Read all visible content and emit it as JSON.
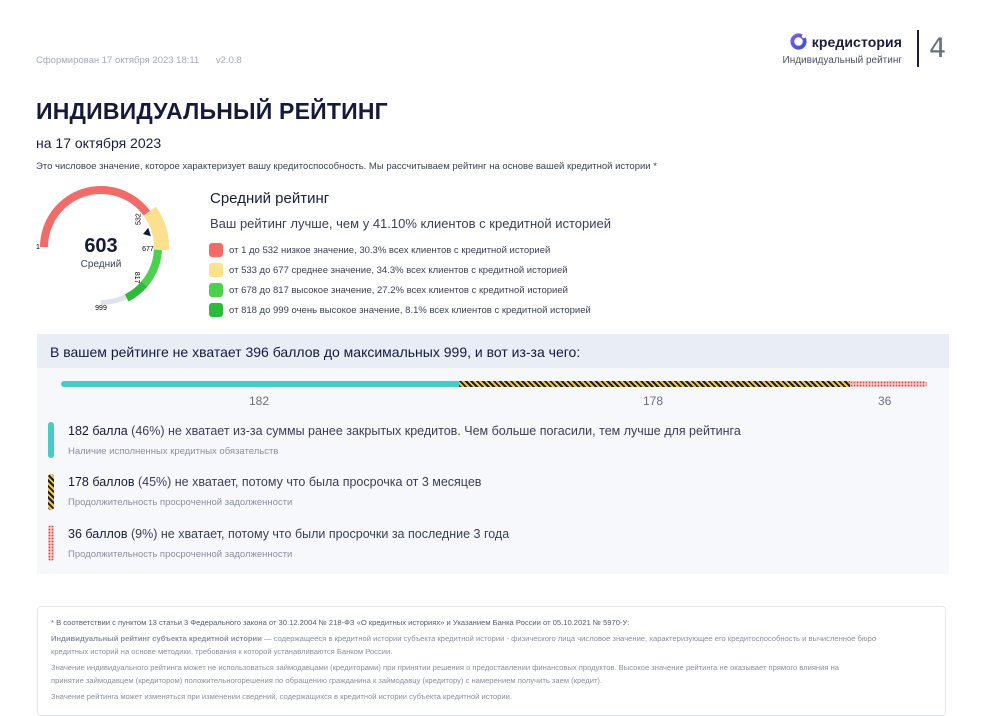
{
  "header": {
    "generated": "Сформирован 17 октября 2023 18:11",
    "version": "v2.0.8",
    "brand_name": "кредистория",
    "brand_sub": "Индивидуальный рейтинг",
    "page_number": "4"
  },
  "title": "ИНДИВИДУАЛЬНЫЙ РЕЙТИНГ",
  "date": "на 17 октября 2023",
  "description": "Это числовое значение, которое характеризует вашу кредитоспособность. Мы рассчитываем рейтинг на основе вашей кредитной истории *",
  "gauge": {
    "value": "603",
    "label": "Средний",
    "score": 603,
    "min": 1,
    "max": 999,
    "ticks": [
      "1",
      "532",
      "677",
      "817",
      "999"
    ],
    "colors": {
      "low": "#f26b6b",
      "mid": "#fbe08e",
      "high": "#4cd14c",
      "very_high": "#2dba3a",
      "track": "#dfe2ec"
    }
  },
  "average": {
    "title": "Средний рейтинг",
    "text": "Ваш рейтинг лучше, чем у 41.10% клиентов с кредитной историей",
    "legend": [
      {
        "color": "#f26b6b",
        "text": "от 1 до 532 низкое значение, 30.3% всех клиентов с кредитной историей"
      },
      {
        "color": "#fbe08e",
        "text": "от 533 до 677 среднее значение, 34.3% всех клиентов с кредитной историей"
      },
      {
        "color": "#4cd14c",
        "text": "от 678 до 817 высокое значение, 27.2% всех клиентов с кредитной историей"
      },
      {
        "color": "#2dba3a",
        "text": "от 818 до 999 очень высокое значение, 8.1% всех клиентов с кредитной историей"
      }
    ]
  },
  "missing": {
    "heading": "В вашем рейтинге не хватает 396 баллов до максимальных 999, и вот из-за чего:",
    "segments": [
      {
        "value": 182,
        "label": "182"
      },
      {
        "value": 178,
        "label": "178"
      },
      {
        "value": 36,
        "label": "36"
      }
    ],
    "reasons": [
      {
        "bold": "182 балла",
        "text": " (46%) не хватает из-за суммы ранее закрытых кредитов. Чем больше погасили, тем лучше для рейтинга",
        "sub": "Наличие исполненных кредитных обязательств"
      },
      {
        "bold": "178 баллов",
        "text": " (45%) не хватает, потому что была просрочка от 3 месяцев",
        "sub": "Продолжительность просроченной задолженности"
      },
      {
        "bold": "36 баллов",
        "text": " (9%) не хватает, потому что были просрочки за последние 3 года",
        "sub": "Продолжительность просроченной задолженности"
      }
    ]
  },
  "footnote": {
    "line1": "* В соответствии с пунктом 13 статьи 3 Федерального закона от 30.12.2004 № 218-ФЗ «О кредитных историях» и Указанием Банка России от 05.10.2021 № 5970-У:",
    "line2_bold": "Индивидуальный рейтинг субъекта кредитной истории",
    "line2": " — содержащееся в кредитной истории субъекта кредитной истории - физического лица числовое значение, характеризующее его кредитоспособность и вычисленное бюро",
    "line3": "кредитных историй на основе методики, требования к которой устанавливаются Банком России.",
    "line4": "Значение индивидуального рейтинга может не использоваться займодавцами (кредиторами) при принятии решения о предоставлении финансовых продуктов. Высокое значение рейтинга не оказывает прямого влияния на",
    "line5": "принятие займодавцем (кредитором) положительногорешения по обращению гражданина к займодавцу (кредитору) с намерением получить заем (кредит).",
    "line6": "Значение рейтинга может изменяться при изменении сведений, содержащихся в кредитной истории субъекта кредитной истории."
  }
}
